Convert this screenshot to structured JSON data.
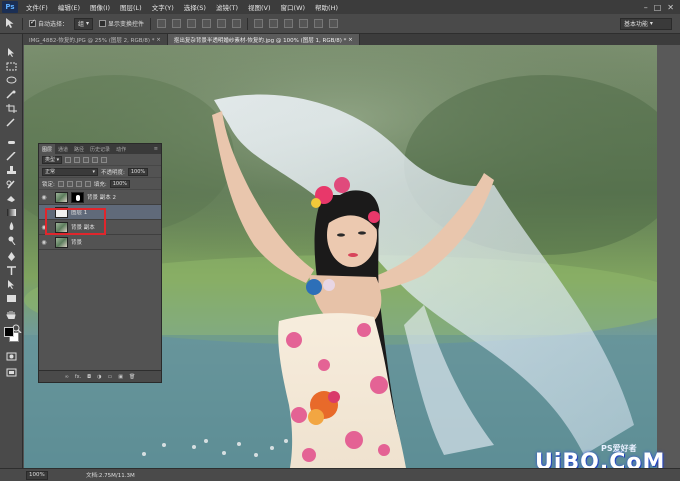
{
  "app": {
    "logo": "Ps",
    "menu": [
      "文件(F)",
      "编辑(E)",
      "图像(I)",
      "图层(L)",
      "文字(Y)",
      "选择(S)",
      "滤镜(T)",
      "视图(V)",
      "窗口(W)",
      "帮助(H)"
    ]
  },
  "options": {
    "auto_select_label": "自动选择：",
    "auto_select_value": "组",
    "show_transform_label": "显示变换控件",
    "workspace": "基本功能"
  },
  "tabs": [
    {
      "label": "IMG_4882-恢复的.JPG @ 25% (图层 2, RGB/8) *"
    },
    {
      "label": "抠出复杂背景半透明婚纱素材-恢复的.jpg @ 100% (图层 1, RGB/8) *"
    }
  ],
  "layers_panel": {
    "tabs": [
      "图层",
      "通道",
      "路径",
      "历史记录",
      "动作"
    ],
    "filter_kind": "类型",
    "blend_mode": "正常",
    "opacity_label": "不透明度:",
    "opacity_value": "100%",
    "lock_label": "锁定:",
    "fill_label": "填充:",
    "fill_value": "100%",
    "layers": [
      {
        "name": "背景 副本 2",
        "visible": true,
        "selected": false,
        "has_mask": true
      },
      {
        "name": "图层 1",
        "visible": false,
        "selected": true,
        "has_mask": false
      },
      {
        "name": "背景 副本",
        "visible": true,
        "selected": false,
        "has_mask": false
      },
      {
        "name": "背景",
        "visible": true,
        "selected": false,
        "has_mask": false
      }
    ],
    "bottom_fx": "fx."
  },
  "status": {
    "zoom": "100%",
    "doc_info": "文档:2.75M/11.3M"
  },
  "watermark": {
    "main": "UiBQ.CoM",
    "sub": "PS爱好者"
  },
  "colors": {
    "menubar_bg": "#3c3c3c",
    "highlight_red": "#e0262c",
    "selected_layer": "#606a7a"
  }
}
